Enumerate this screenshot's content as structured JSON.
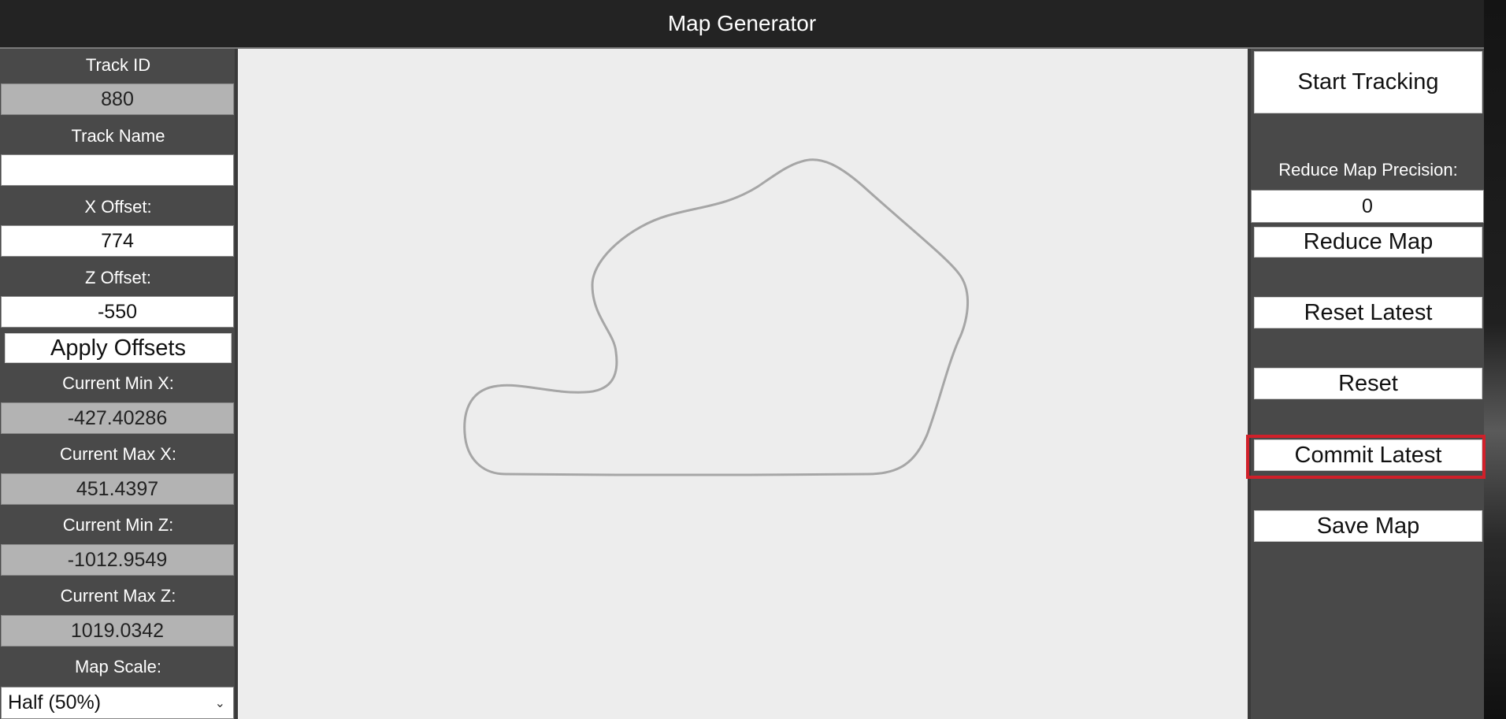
{
  "window": {
    "title": "Map Generator"
  },
  "left_panel": {
    "track_id_label": "Track ID",
    "track_id_value": "880",
    "track_name_label": "Track Name",
    "track_name_value": "",
    "x_offset_label": "X Offset:",
    "x_offset_value": "774",
    "z_offset_label": "Z Offset:",
    "z_offset_value": "-550",
    "apply_offsets_label": "Apply Offsets",
    "min_x_label": "Current Min X:",
    "min_x_value": "-427.40286",
    "max_x_label": "Current Max X:",
    "max_x_value": "451.4397",
    "min_z_label": "Current Min Z:",
    "min_z_value": "-1012.9549",
    "max_z_label": "Current Max Z:",
    "max_z_value": "1019.0342",
    "map_scale_label": "Map Scale:",
    "map_scale_value": "Half (50%)"
  },
  "right_panel": {
    "start_tracking_label": "Start Tracking",
    "precision_label": "Reduce Map Precision:",
    "precision_value": "0",
    "reduce_map_label": "Reduce Map",
    "reset_latest_label": "Reset Latest",
    "reset_label": "Reset",
    "commit_latest_label": "Commit Latest",
    "save_map_label": "Save Map"
  },
  "canvas": {
    "track_stroke_color": "#a6a6a6",
    "background_color": "#ededed"
  },
  "colors": {
    "panel": "#494949",
    "highlight": "#d0202a"
  },
  "icons": {
    "select_chevron": "chevron-down-icon"
  }
}
